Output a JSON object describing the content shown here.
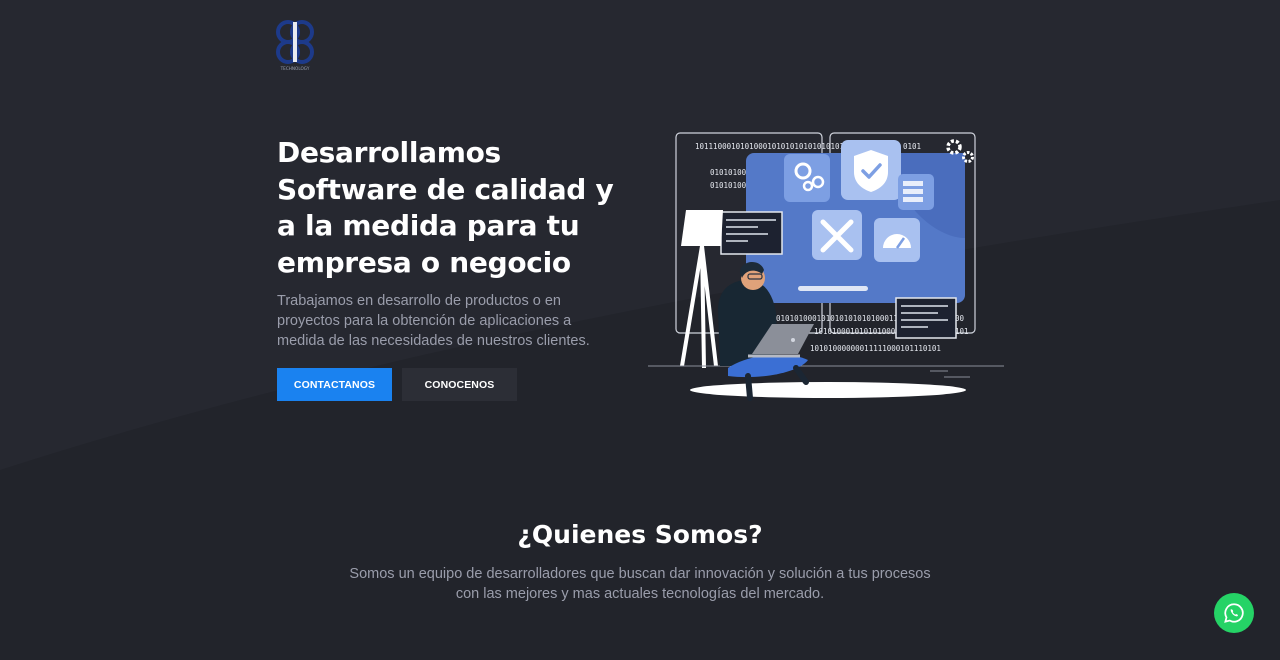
{
  "brand": {
    "logo_text": "TECHNOLOGY"
  },
  "hero": {
    "title": "Desarrollamos Software de calidad y a la medida para tu empresa o negocio",
    "subtitle": "Trabajamos en desarrollo de productos o en proyectos para la obtención de aplicaciones a medida de las necesidades de nuestros clientes.",
    "buttons": {
      "contact": "CONTACTANOS",
      "about": "CONOCENOS"
    }
  },
  "illustration": {
    "binary_lines": [
      "1011100010101000101010101010101010000",
      "010101000",
      "010101000",
      "0001010100010101010101010001111101010",
      "10101000101010100000",
      "10101000000011111000101110101",
      "0101",
      "00",
      "101"
    ]
  },
  "about": {
    "title": "¿Quienes Somos?",
    "text": "Somos un equipo de desarrolladores que buscan dar innovación y solución a tus procesos con las mejores y mas actuales tecnologías del mercado."
  },
  "whatsapp": {
    "icon": "whatsapp-icon"
  },
  "colors": {
    "background": "#22242b",
    "primary_button": "#1a82f0",
    "secondary_button": "#2c2e36",
    "whatsapp": "#25d366",
    "illustration_panel": "#4f77c9"
  }
}
